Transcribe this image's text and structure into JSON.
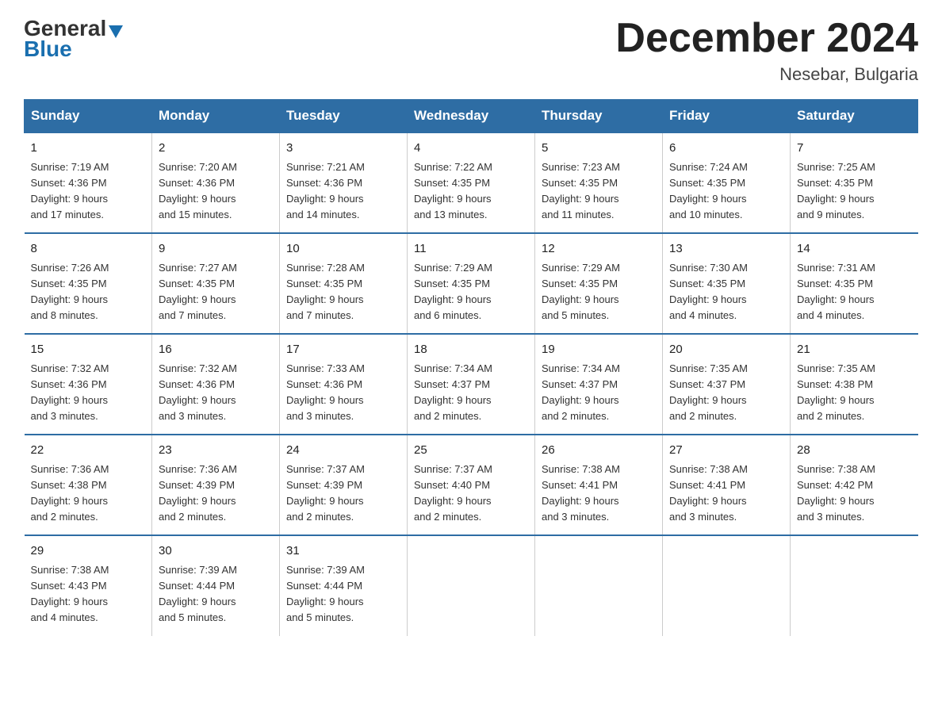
{
  "logo": {
    "general": "General",
    "blue": "Blue",
    "triangle": "▼"
  },
  "title": "December 2024",
  "subtitle": "Nesebar, Bulgaria",
  "days_of_week": [
    "Sunday",
    "Monday",
    "Tuesday",
    "Wednesday",
    "Thursday",
    "Friday",
    "Saturday"
  ],
  "weeks": [
    [
      {
        "day": "1",
        "sunrise": "7:19 AM",
        "sunset": "4:36 PM",
        "daylight": "9 hours and 17 minutes."
      },
      {
        "day": "2",
        "sunrise": "7:20 AM",
        "sunset": "4:36 PM",
        "daylight": "9 hours and 15 minutes."
      },
      {
        "day": "3",
        "sunrise": "7:21 AM",
        "sunset": "4:36 PM",
        "daylight": "9 hours and 14 minutes."
      },
      {
        "day": "4",
        "sunrise": "7:22 AM",
        "sunset": "4:35 PM",
        "daylight": "9 hours and 13 minutes."
      },
      {
        "day": "5",
        "sunrise": "7:23 AM",
        "sunset": "4:35 PM",
        "daylight": "9 hours and 11 minutes."
      },
      {
        "day": "6",
        "sunrise": "7:24 AM",
        "sunset": "4:35 PM",
        "daylight": "9 hours and 10 minutes."
      },
      {
        "day": "7",
        "sunrise": "7:25 AM",
        "sunset": "4:35 PM",
        "daylight": "9 hours and 9 minutes."
      }
    ],
    [
      {
        "day": "8",
        "sunrise": "7:26 AM",
        "sunset": "4:35 PM",
        "daylight": "9 hours and 8 minutes."
      },
      {
        "day": "9",
        "sunrise": "7:27 AM",
        "sunset": "4:35 PM",
        "daylight": "9 hours and 7 minutes."
      },
      {
        "day": "10",
        "sunrise": "7:28 AM",
        "sunset": "4:35 PM",
        "daylight": "9 hours and 7 minutes."
      },
      {
        "day": "11",
        "sunrise": "7:29 AM",
        "sunset": "4:35 PM",
        "daylight": "9 hours and 6 minutes."
      },
      {
        "day": "12",
        "sunrise": "7:29 AM",
        "sunset": "4:35 PM",
        "daylight": "9 hours and 5 minutes."
      },
      {
        "day": "13",
        "sunrise": "7:30 AM",
        "sunset": "4:35 PM",
        "daylight": "9 hours and 4 minutes."
      },
      {
        "day": "14",
        "sunrise": "7:31 AM",
        "sunset": "4:35 PM",
        "daylight": "9 hours and 4 minutes."
      }
    ],
    [
      {
        "day": "15",
        "sunrise": "7:32 AM",
        "sunset": "4:36 PM",
        "daylight": "9 hours and 3 minutes."
      },
      {
        "day": "16",
        "sunrise": "7:32 AM",
        "sunset": "4:36 PM",
        "daylight": "9 hours and 3 minutes."
      },
      {
        "day": "17",
        "sunrise": "7:33 AM",
        "sunset": "4:36 PM",
        "daylight": "9 hours and 3 minutes."
      },
      {
        "day": "18",
        "sunrise": "7:34 AM",
        "sunset": "4:37 PM",
        "daylight": "9 hours and 2 minutes."
      },
      {
        "day": "19",
        "sunrise": "7:34 AM",
        "sunset": "4:37 PM",
        "daylight": "9 hours and 2 minutes."
      },
      {
        "day": "20",
        "sunrise": "7:35 AM",
        "sunset": "4:37 PM",
        "daylight": "9 hours and 2 minutes."
      },
      {
        "day": "21",
        "sunrise": "7:35 AM",
        "sunset": "4:38 PM",
        "daylight": "9 hours and 2 minutes."
      }
    ],
    [
      {
        "day": "22",
        "sunrise": "7:36 AM",
        "sunset": "4:38 PM",
        "daylight": "9 hours and 2 minutes."
      },
      {
        "day": "23",
        "sunrise": "7:36 AM",
        "sunset": "4:39 PM",
        "daylight": "9 hours and 2 minutes."
      },
      {
        "day": "24",
        "sunrise": "7:37 AM",
        "sunset": "4:39 PM",
        "daylight": "9 hours and 2 minutes."
      },
      {
        "day": "25",
        "sunrise": "7:37 AM",
        "sunset": "4:40 PM",
        "daylight": "9 hours and 2 minutes."
      },
      {
        "day": "26",
        "sunrise": "7:38 AM",
        "sunset": "4:41 PM",
        "daylight": "9 hours and 3 minutes."
      },
      {
        "day": "27",
        "sunrise": "7:38 AM",
        "sunset": "4:41 PM",
        "daylight": "9 hours and 3 minutes."
      },
      {
        "day": "28",
        "sunrise": "7:38 AM",
        "sunset": "4:42 PM",
        "daylight": "9 hours and 3 minutes."
      }
    ],
    [
      {
        "day": "29",
        "sunrise": "7:38 AM",
        "sunset": "4:43 PM",
        "daylight": "9 hours and 4 minutes."
      },
      {
        "day": "30",
        "sunrise": "7:39 AM",
        "sunset": "4:44 PM",
        "daylight": "9 hours and 5 minutes."
      },
      {
        "day": "31",
        "sunrise": "7:39 AM",
        "sunset": "4:44 PM",
        "daylight": "9 hours and 5 minutes."
      },
      {
        "day": "",
        "sunrise": "",
        "sunset": "",
        "daylight": ""
      },
      {
        "day": "",
        "sunrise": "",
        "sunset": "",
        "daylight": ""
      },
      {
        "day": "",
        "sunrise": "",
        "sunset": "",
        "daylight": ""
      },
      {
        "day": "",
        "sunrise": "",
        "sunset": "",
        "daylight": ""
      }
    ]
  ],
  "labels": {
    "sunrise": "Sunrise:",
    "sunset": "Sunset:",
    "daylight": "Daylight:"
  }
}
